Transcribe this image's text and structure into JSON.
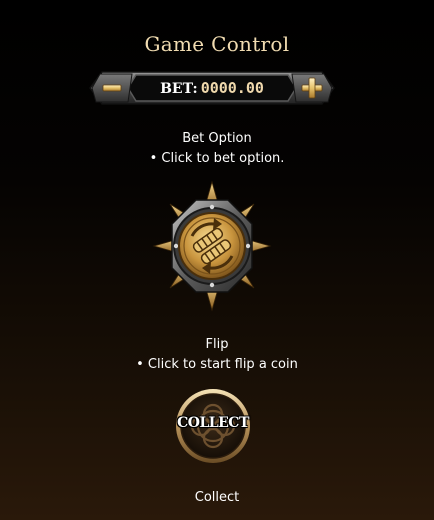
{
  "title": "Game Control",
  "bet": {
    "label": "BET:",
    "value": "0000.00",
    "minus_icon": "minus-icon",
    "plus_icon": "plus-icon"
  },
  "bet_option": {
    "title": "Bet Option",
    "description": "• Click to bet option.",
    "icon": "bet-option-medal-icon"
  },
  "flip": {
    "title": "Flip",
    "description": "• Click to start flip a coin"
  },
  "collect": {
    "button_label": "COLLECT",
    "title": "Collect"
  },
  "colors": {
    "gold": "#c89b4a",
    "title_gold": "#f1dcb1",
    "bet_value": "#f0d9ad"
  }
}
